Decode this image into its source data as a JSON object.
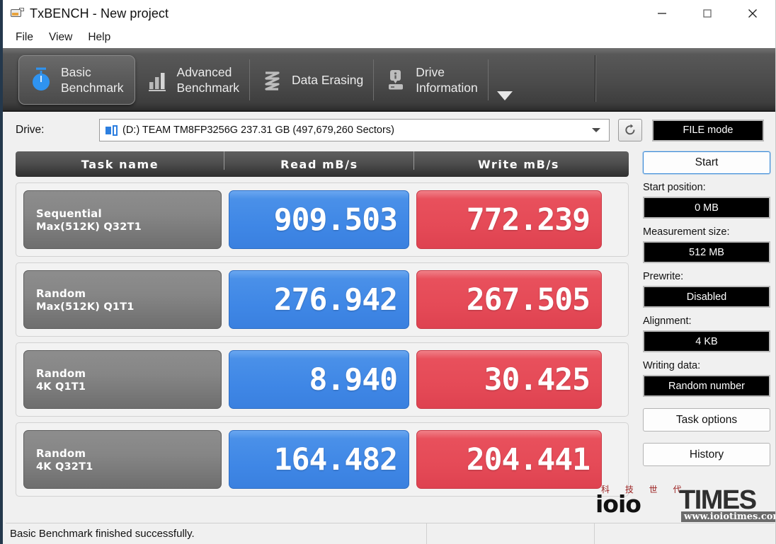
{
  "window": {
    "title": "TxBENCH - New project",
    "icon": "drive-app-icon",
    "controls": {
      "minimize": "minimize-icon",
      "maximize": "maximize-icon",
      "close": "close-icon"
    }
  },
  "menubar": {
    "items": [
      {
        "label": "File"
      },
      {
        "label": "View"
      },
      {
        "label": "Help"
      }
    ]
  },
  "tabs": {
    "items": [
      {
        "line1": "Basic",
        "line2": "Benchmark",
        "icon": "stopwatch-icon",
        "active": true
      },
      {
        "line1": "Advanced",
        "line2": "Benchmark",
        "icon": "bar-chart-icon",
        "active": false
      },
      {
        "line1": "Data Erasing",
        "line2": "",
        "icon": "zigzag-shred-icon",
        "active": false
      },
      {
        "line1": "Drive",
        "line2": "Information",
        "icon": "drive-info-icon",
        "active": false
      }
    ],
    "more_icon": "chevron-down-icon"
  },
  "drive": {
    "label": "Drive:",
    "selected": "(D:) TEAM TM8FP3256G  237.31 GB (497,679,260 Sectors)",
    "dropdown_icon": "chevron-down-icon",
    "drive_icon": "drive-icon",
    "refresh_icon": "refresh-icon",
    "mode_badge": "FILE mode"
  },
  "results": {
    "columns": [
      "Task name",
      "Read mB/s",
      "Write mB/s"
    ],
    "rows": [
      {
        "task_line1": "Sequential",
        "task_line2": "Max(512K) Q32T1",
        "read": "909.503",
        "write": "772.239"
      },
      {
        "task_line1": "Random",
        "task_line2": "Max(512K) Q1T1",
        "read": "276.942",
        "write": "267.505"
      },
      {
        "task_line1": "Random",
        "task_line2": "4K Q1T1",
        "read": "8.940",
        "write": "30.425"
      },
      {
        "task_line1": "Random",
        "task_line2": "4K Q32T1",
        "read": "164.482",
        "write": "204.441"
      }
    ]
  },
  "sidebar": {
    "start_button": "Start",
    "fields": [
      {
        "label": "Start position:",
        "value": "0 MB"
      },
      {
        "label": "Measurement size:",
        "value": "512 MB"
      },
      {
        "label": "Prewrite:",
        "value": "Disabled"
      },
      {
        "label": "Alignment:",
        "value": "4 KB"
      },
      {
        "label": "Writing data:",
        "value": "Random number"
      }
    ],
    "buttons": [
      {
        "label": "Task options"
      },
      {
        "label": "History"
      }
    ]
  },
  "statusbar": {
    "message": "Basic Benchmark finished successfully."
  },
  "watermark": {
    "chinese": "科 技 世 代",
    "brand": "ioio",
    "brand2": "TIMES",
    "url": "www.ioiotimes.com"
  },
  "colors": {
    "read_blue": "#4a90e8",
    "write_red": "#e8505c",
    "tab_dark": "#4b4b4b",
    "accent_border": "#3a8ad8"
  }
}
